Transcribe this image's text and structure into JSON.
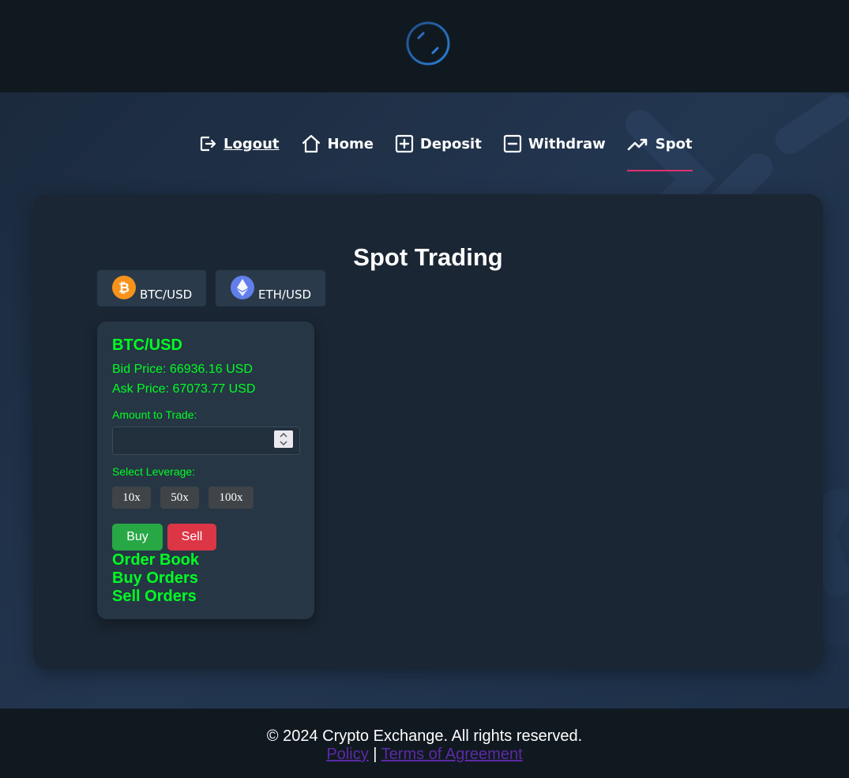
{
  "nav": {
    "items": [
      {
        "label": "Logout",
        "icon": "logout-icon"
      },
      {
        "label": "Home",
        "icon": "home-icon"
      },
      {
        "label": "Deposit",
        "icon": "plus-square-icon"
      },
      {
        "label": "Withdraw",
        "icon": "minus-square-icon"
      },
      {
        "label": "Spot",
        "icon": "trending-up-icon",
        "active": true
      }
    ]
  },
  "main": {
    "title": "Spot Trading",
    "pairs": [
      {
        "label": "BTC/USD",
        "icon": "bitcoin-icon",
        "color": "#f7931a"
      },
      {
        "label": "ETH/USD",
        "icon": "ethereum-icon",
        "color": "#627eea"
      }
    ]
  },
  "trade": {
    "pair": "BTC/USD",
    "bid_text": "Bid Price: 66936.16 USD",
    "ask_text": "Ask Price: 67073.77 USD",
    "amount_label": "Amount to Trade:",
    "amount_value": "",
    "leverage_label": "Select Leverage:",
    "leverage_options": [
      "10x",
      "50x",
      "100x"
    ],
    "buy_label": "Buy",
    "sell_label": "Sell",
    "order_book": "Order Book",
    "buy_orders": "Buy Orders",
    "sell_orders": "Sell Orders"
  },
  "footer": {
    "copyright": "© 2024 Crypto Exchange. All rights reserved.",
    "policy": "Policy",
    "separator": "|",
    "terms": "Terms of Agreement"
  },
  "colors": {
    "accent_underline": "#e0306c",
    "text_green": "#00ff22",
    "buy": "#28a745",
    "sell": "#dc3545",
    "link": "#5b2aa8"
  }
}
